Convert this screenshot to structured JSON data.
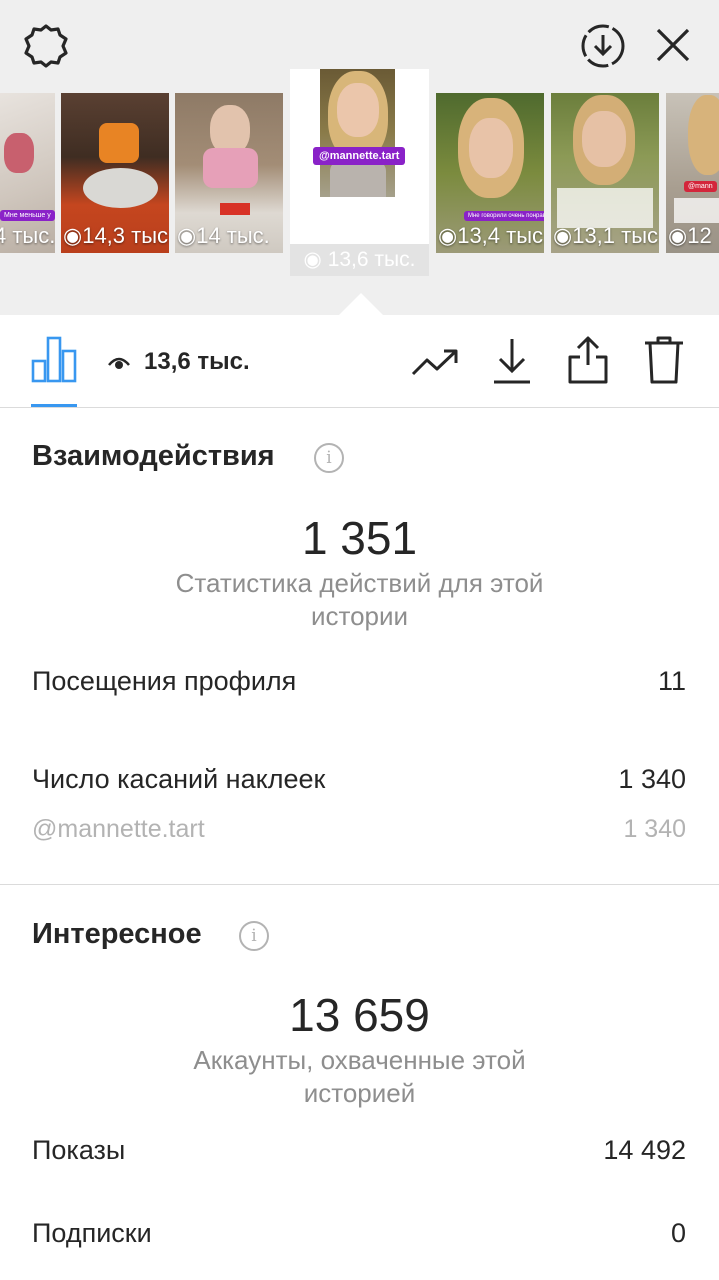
{
  "header": {
    "settings_icon": "settings-gear-icon",
    "save_icon": "circle-download-icon",
    "close_icon": "close-x-icon"
  },
  "stories": [
    {
      "views": "4 тыс.",
      "sticker": "Мне меньше у"
    },
    {
      "views": "14,3 тыс."
    },
    {
      "views": "14 тыс."
    },
    {
      "views": "13,6 тыс.",
      "sticker": "@mannette.tart",
      "selected": true
    },
    {
      "views": "13,4 тыс.",
      "sticker": "Мне говорили очень понравилось ..."
    },
    {
      "views": "13,1 тыс."
    },
    {
      "views": "12",
      "sticker": "@mann"
    }
  ],
  "toolbar": {
    "views": "13,6 тыс.",
    "icons": [
      "bar-chart-icon",
      "eye-icon",
      "trend-icon",
      "download-icon",
      "share-icon",
      "trash-icon"
    ]
  },
  "interactions": {
    "title": "Взаимодействия",
    "total": "1 351",
    "subtitle": "Статистика действий для этой истории",
    "rows": [
      {
        "label": "Посещения профиля",
        "value": "11"
      },
      {
        "label": "Число касаний наклеек",
        "value": "1 340"
      },
      {
        "label": "@mannette.tart",
        "value": "1 340"
      }
    ]
  },
  "discovery": {
    "title": "Интересное",
    "total": "13 659",
    "subtitle": "Аккаунты, охваченные этой историей",
    "rows": [
      {
        "label": "Показы",
        "value": "14 492"
      },
      {
        "label": "Подписки",
        "value": "0"
      }
    ]
  },
  "colors": {
    "accent": "#3897f0",
    "sticker": "#8a22c8",
    "muted": "#8e8e8e",
    "divider": "#dbdbdb"
  }
}
